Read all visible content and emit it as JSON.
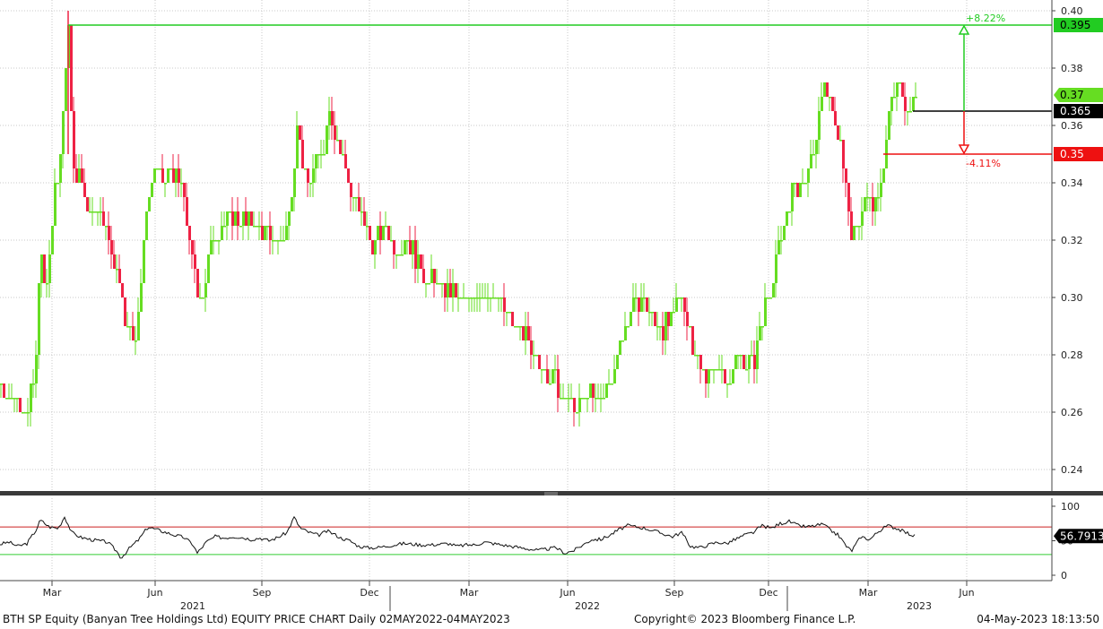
{
  "footer": {
    "left": "BTH SP Equity (Banyan Tree Holdings Ltd) EQUITY PRICE CHART  Daily 02MAY2022-04MAY2023",
    "copyright": "Copyright© 2023 Bloomberg Finance L.P.",
    "timestamp": "04-May-2023 18:13:50"
  },
  "colors": {
    "up": "#66dd22",
    "down": "#ee2244",
    "target_up": "#22cc22",
    "target_down": "#ee1111",
    "last": "#000000",
    "grid": "#c8c8c8",
    "rsi_upper": "#cc2222",
    "rsi_lower": "#33cc33"
  },
  "chart_data": [
    {
      "type": "candlestick",
      "y_ticks": [
        "0.40",
        "0.38",
        "0.36",
        "0.34",
        "0.32",
        "0.30",
        "0.28",
        "0.26",
        "0.24"
      ],
      "x_month_labels": [
        "Mar",
        "Jun",
        "Sep",
        "Dec",
        "Mar",
        "Jun",
        "Sep",
        "Dec",
        "Mar",
        "Jun"
      ],
      "x_year_labels": [
        "2021",
        "2022",
        "2023"
      ],
      "ylim": [
        0.23,
        0.4
      ],
      "grid": true,
      "levels": {
        "high_target": {
          "value": 0.395,
          "label": "0.395",
          "pct_label": "+8.22%"
        },
        "last": {
          "value": 0.365,
          "label": "0.365"
        },
        "current": {
          "value": 0.37,
          "label": "0.37"
        },
        "low_target": {
          "value": 0.35,
          "label": "0.35",
          "pct_label": "-4.11%"
        }
      },
      "keypoints": [
        [
          0,
          0.27
        ],
        [
          10,
          0.265
        ],
        [
          20,
          0.265
        ],
        [
          30,
          0.26
        ],
        [
          40,
          0.28
        ],
        [
          43,
          0.32
        ],
        [
          50,
          0.3
        ],
        [
          58,
          0.33
        ],
        [
          66,
          0.35
        ],
        [
          72,
          0.38
        ],
        [
          75,
          0.39
        ],
        [
          80,
          0.35
        ],
        [
          85,
          0.34
        ],
        [
          90,
          0.345
        ],
        [
          95,
          0.33
        ],
        [
          110,
          0.33
        ],
        [
          120,
          0.32
        ],
        [
          130,
          0.31
        ],
        [
          140,
          0.29
        ],
        [
          148,
          0.285
        ],
        [
          155,
          0.3
        ],
        [
          162,
          0.33
        ],
        [
          170,
          0.345
        ],
        [
          180,
          0.34
        ],
        [
          190,
          0.345
        ],
        [
          200,
          0.34
        ],
        [
          210,
          0.32
        ],
        [
          220,
          0.3
        ],
        [
          228,
          0.305
        ],
        [
          235,
          0.32
        ],
        [
          245,
          0.325
        ],
        [
          260,
          0.33
        ],
        [
          275,
          0.325
        ],
        [
          285,
          0.325
        ],
        [
          300,
          0.32
        ],
        [
          315,
          0.32
        ],
        [
          322,
          0.33
        ],
        [
          330,
          0.36
        ],
        [
          340,
          0.34
        ],
        [
          350,
          0.345
        ],
        [
          358,
          0.35
        ],
        [
          366,
          0.365
        ],
        [
          372,
          0.355
        ],
        [
          380,
          0.35
        ],
        [
          390,
          0.335
        ],
        [
          400,
          0.33
        ],
        [
          410,
          0.32
        ],
        [
          420,
          0.32
        ],
        [
          430,
          0.325
        ],
        [
          440,
          0.315
        ],
        [
          450,
          0.32
        ],
        [
          460,
          0.315
        ],
        [
          470,
          0.31
        ],
        [
          480,
          0.305
        ],
        [
          490,
          0.305
        ],
        [
          500,
          0.3
        ],
        [
          510,
          0.3
        ],
        [
          520,
          0.3
        ],
        [
          530,
          0.3
        ],
        [
          540,
          0.3
        ],
        [
          550,
          0.3
        ],
        [
          560,
          0.295
        ],
        [
          570,
          0.29
        ],
        [
          580,
          0.29
        ],
        [
          590,
          0.28
        ],
        [
          600,
          0.275
        ],
        [
          610,
          0.275
        ],
        [
          620,
          0.27
        ],
        [
          630,
          0.265
        ],
        [
          640,
          0.26
        ],
        [
          650,
          0.265
        ],
        [
          660,
          0.265
        ],
        [
          670,
          0.265
        ],
        [
          680,
          0.27
        ],
        [
          690,
          0.285
        ],
        [
          700,
          0.295
        ],
        [
          710,
          0.3
        ],
        [
          720,
          0.295
        ],
        [
          730,
          0.29
        ],
        [
          740,
          0.29
        ],
        [
          750,
          0.295
        ],
        [
          760,
          0.3
        ],
        [
          770,
          0.285
        ],
        [
          780,
          0.275
        ],
        [
          790,
          0.275
        ],
        [
          800,
          0.275
        ],
        [
          810,
          0.27
        ],
        [
          820,
          0.28
        ],
        [
          830,
          0.275
        ],
        [
          840,
          0.28
        ],
        [
          850,
          0.295
        ],
        [
          860,
          0.305
        ],
        [
          870,
          0.32
        ],
        [
          880,
          0.335
        ],
        [
          890,
          0.34
        ],
        [
          900,
          0.345
        ],
        [
          910,
          0.36
        ],
        [
          918,
          0.375
        ],
        [
          925,
          0.365
        ],
        [
          935,
          0.355
        ],
        [
          942,
          0.34
        ],
        [
          948,
          0.32
        ],
        [
          955,
          0.325
        ],
        [
          962,
          0.335
        ],
        [
          970,
          0.335
        ],
        [
          978,
          0.335
        ],
        [
          985,
          0.35
        ],
        [
          990,
          0.365
        ],
        [
          995,
          0.37
        ],
        [
          1000,
          0.375
        ],
        [
          1005,
          0.37
        ],
        [
          1010,
          0.37
        ],
        [
          1015,
          0.365
        ],
        [
          1020,
          0.37
        ]
      ]
    },
    {
      "type": "line",
      "name": "RSI",
      "y_ticks": [
        "100",
        "50",
        "0"
      ],
      "ylim": [
        0,
        100
      ],
      "upper_band": 70,
      "lower_band": 30,
      "last_label": "56.7913",
      "keypoints": [
        [
          0,
          45
        ],
        [
          10,
          48
        ],
        [
          20,
          42
        ],
        [
          30,
          46
        ],
        [
          40,
          65
        ],
        [
          45,
          80
        ],
        [
          55,
          70
        ],
        [
          65,
          68
        ],
        [
          72,
          85
        ],
        [
          80,
          62
        ],
        [
          90,
          55
        ],
        [
          100,
          52
        ],
        [
          110,
          50
        ],
        [
          120,
          48
        ],
        [
          130,
          35
        ],
        [
          135,
          25
        ],
        [
          145,
          40
        ],
        [
          155,
          52
        ],
        [
          165,
          70
        ],
        [
          175,
          66
        ],
        [
          185,
          62
        ],
        [
          195,
          58
        ],
        [
          205,
          55
        ],
        [
          215,
          45
        ],
        [
          220,
          32
        ],
        [
          230,
          48
        ],
        [
          240,
          56
        ],
        [
          250,
          54
        ],
        [
          260,
          56
        ],
        [
          270,
          55
        ],
        [
          280,
          52
        ],
        [
          290,
          54
        ],
        [
          300,
          50
        ],
        [
          310,
          55
        ],
        [
          320,
          62
        ],
        [
          328,
          84
        ],
        [
          335,
          68
        ],
        [
          345,
          62
        ],
        [
          355,
          58
        ],
        [
          365,
          64
        ],
        [
          372,
          60
        ],
        [
          380,
          54
        ],
        [
          390,
          50
        ],
        [
          400,
          42
        ],
        [
          410,
          40
        ],
        [
          420,
          40
        ],
        [
          430,
          42
        ],
        [
          440,
          44
        ],
        [
          450,
          46
        ],
        [
          460,
          45
        ],
        [
          470,
          44
        ],
        [
          480,
          44
        ],
        [
          490,
          45
        ],
        [
          500,
          46
        ],
        [
          510,
          42
        ],
        [
          520,
          44
        ],
        [
          530,
          44
        ],
        [
          540,
          48
        ],
        [
          550,
          46
        ],
        [
          560,
          44
        ],
        [
          570,
          42
        ],
        [
          580,
          40
        ],
        [
          590,
          38
        ],
        [
          600,
          36
        ],
        [
          610,
          38
        ],
        [
          620,
          40
        ],
        [
          630,
          32
        ],
        [
          640,
          36
        ],
        [
          650,
          44
        ],
        [
          660,
          52
        ],
        [
          670,
          52
        ],
        [
          680,
          58
        ],
        [
          690,
          66
        ],
        [
          700,
          72
        ],
        [
          710,
          70
        ],
        [
          720,
          68
        ],
        [
          730,
          64
        ],
        [
          740,
          60
        ],
        [
          750,
          56
        ],
        [
          760,
          62
        ],
        [
          770,
          42
        ],
        [
          780,
          40
        ],
        [
          790,
          44
        ],
        [
          800,
          48
        ],
        [
          810,
          46
        ],
        [
          820,
          52
        ],
        [
          830,
          58
        ],
        [
          840,
          62
        ],
        [
          850,
          72
        ],
        [
          860,
          68
        ],
        [
          870,
          75
        ],
        [
          880,
          78
        ],
        [
          890,
          72
        ],
        [
          900,
          70
        ],
        [
          910,
          72
        ],
        [
          918,
          74
        ],
        [
          925,
          66
        ],
        [
          935,
          58
        ],
        [
          945,
          40
        ],
        [
          950,
          36
        ],
        [
          960,
          56
        ],
        [
          970,
          52
        ],
        [
          980,
          64
        ],
        [
          990,
          72
        ],
        [
          1000,
          68
        ],
        [
          1010,
          62
        ],
        [
          1020,
          56.8
        ]
      ]
    }
  ]
}
